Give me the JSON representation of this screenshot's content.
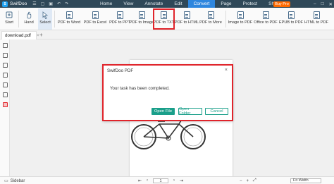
{
  "app": {
    "name": "SwifDoo"
  },
  "menu": [
    "Home",
    "View",
    "Annotate",
    "Edit",
    "Convert",
    "Page",
    "Protect",
    "Share"
  ],
  "menu_active": "Convert",
  "buy_pro": "Buy Pro",
  "toolbar": {
    "start": "Start",
    "hand": "Hand",
    "select": "Select",
    "pdf_to_word": "PDF to Word",
    "pdf_to_excel": "PDF to Excel",
    "pdf_to_ppt": "PDF to PPT",
    "pdf_to_image": "PDF to Image",
    "pdf_to_txt": "PDF to TXT",
    "pdf_to_html": "PDF to HTML",
    "pdf_to_more": "PDF to More",
    "image_to_pdf": "Image to PDF",
    "office_to_pdf": "Office to PDF",
    "epub_to_pdf": "EPUB to PDF",
    "html_to_pdf": "HTML to PDF"
  },
  "tab": {
    "label": "download.pdf"
  },
  "dialog": {
    "title": "SwifDoo PDF",
    "message": "Your task has been completed.",
    "open_file": "Open File",
    "open_folder": "Open Folder",
    "cancel": "Cancel"
  },
  "status": {
    "sidebar": "Sidebar",
    "page": "1",
    "zoom": "Fit Width"
  },
  "colors": {
    "accent": "#1a9f8a",
    "highlight": "#e0242b",
    "titlebar": "#2f4858",
    "buy_pro": "#ff6a00"
  }
}
